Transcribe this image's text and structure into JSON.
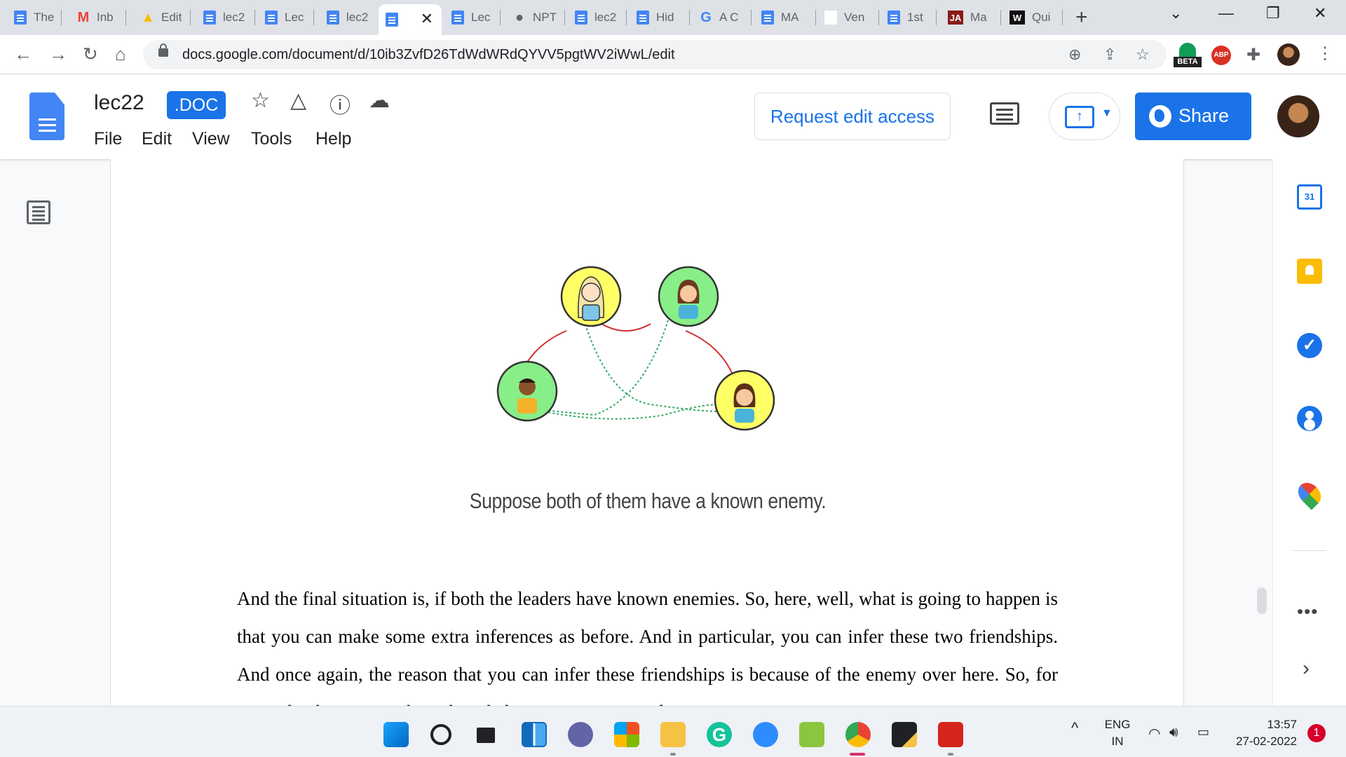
{
  "browser": {
    "tabs": [
      {
        "title": "The",
        "icon": "docs-icon"
      },
      {
        "title": "Inb",
        "icon": "gmail-icon"
      },
      {
        "title": "Edit",
        "icon": "drive-icon"
      },
      {
        "title": "lec2",
        "icon": "docs-icon"
      },
      {
        "title": "Lec",
        "icon": "docs-icon"
      },
      {
        "title": "lec2",
        "icon": "docs-icon"
      },
      {
        "title": "",
        "icon": "docs-icon",
        "active": true
      },
      {
        "title": "Lec",
        "icon": "docs-icon"
      },
      {
        "title": "NPT",
        "icon": "globe-icon"
      },
      {
        "title": "lec2",
        "icon": "docs-icon"
      },
      {
        "title": "Hid",
        "icon": "docs-icon"
      },
      {
        "title": "A C",
        "icon": "google-icon"
      },
      {
        "title": "MA",
        "icon": "docs-icon"
      },
      {
        "title": "Ven",
        "icon": "blank-icon"
      },
      {
        "title": "1st",
        "icon": "docs-icon"
      },
      {
        "title": "Ma",
        "icon": "ja-icon",
        "badge": "JA"
      },
      {
        "title": "Qui",
        "icon": "w-icon",
        "badge": "W"
      }
    ],
    "url": "docs.google.com/document/d/10ib3ZvfD26TdWdWRdQYVV5pgtWV2iWwL/edit",
    "beta_label": "BETA",
    "abp_label": "ABP"
  },
  "docs": {
    "title": "lec22",
    "badge": ".DOC",
    "menu": [
      "File",
      "Edit",
      "View",
      "Tools",
      "Help"
    ],
    "request_access": "Request edit access",
    "share": "Share"
  },
  "content": {
    "caption": "Suppose both of them have a known enemy.",
    "paragraph": "And the final situation is, if both the leaders have known enemies. So, here, well, what is going to happen is that you can make some extra inferences as before. And in particular, you can infer these two friendships. And once again, the reason that you can infer these friendships is because of the enemy over here. So, for example, these are in the red circle here, some enemy of"
  },
  "diagram": {
    "people": [
      {
        "id": "leader-left",
        "fill": "#ffff66"
      },
      {
        "id": "leader-right",
        "fill": "#88ee88"
      },
      {
        "id": "follower-left",
        "fill": "#88ee88"
      },
      {
        "id": "follower-right",
        "fill": "#ffff66"
      }
    ],
    "enemy_color": "#d03030",
    "friend_color": "#33aa66"
  },
  "side_panel": {
    "calendar_day": "31"
  },
  "taskbar": {
    "lang_top": "ENG",
    "lang_bottom": "IN",
    "time": "13:57",
    "date": "27-02-2022",
    "notifications": "1"
  }
}
